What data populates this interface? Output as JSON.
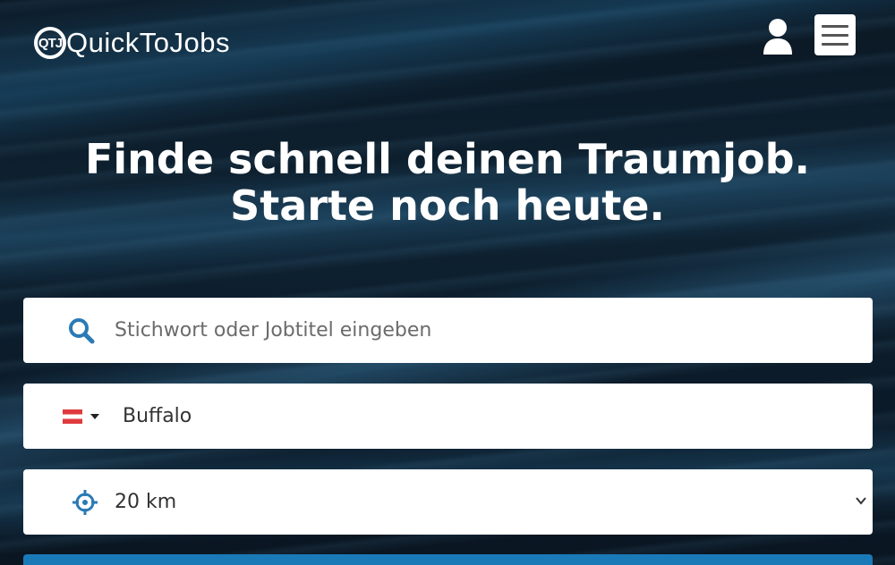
{
  "brand": {
    "logo_initials": "QTJ",
    "name": "QuickToJobs"
  },
  "header": {
    "user_icon": "user-icon",
    "menu_icon": "hamburger-menu-icon"
  },
  "hero": {
    "line1": "Finde schnell deinen Traumjob.",
    "line2": "Starte noch heute."
  },
  "search": {
    "keyword_placeholder": "Stichwort oder Jobtitel eingeben",
    "location_value": "Buffalo",
    "country_flag": "austria-flag",
    "radius_value": "20 km"
  },
  "colors": {
    "accent": "#1a7ab8",
    "icon_blue": "#2a7ab5"
  }
}
